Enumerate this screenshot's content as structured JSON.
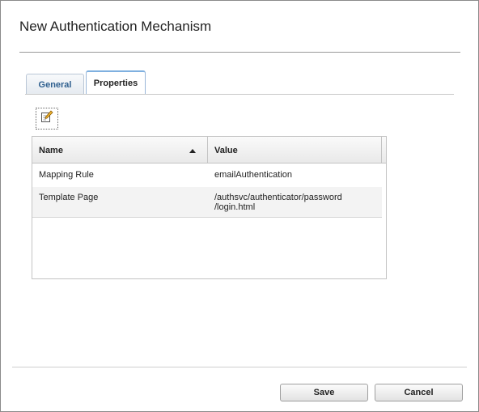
{
  "dialog": {
    "title": "New Authentication Mechanism"
  },
  "tabs": [
    {
      "label": "General",
      "active": false
    },
    {
      "label": "Properties",
      "active": true
    }
  ],
  "toolbar": {
    "edit_icon": "edit-pencil-icon"
  },
  "grid": {
    "columns": [
      {
        "label": "Name",
        "sort": "ascending"
      },
      {
        "label": "Value"
      }
    ],
    "rows": [
      {
        "name": "Mapping Rule",
        "value": "emailAuthentication"
      },
      {
        "name": "Template Page",
        "value": "/authsvc/authenticator/password /login.html"
      }
    ]
  },
  "buttons": {
    "save": "Save",
    "cancel": "Cancel"
  }
}
